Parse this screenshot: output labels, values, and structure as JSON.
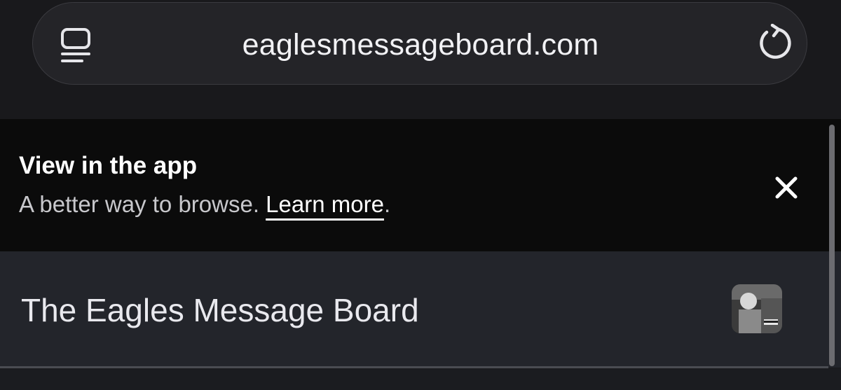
{
  "browser": {
    "url": "eaglesmessageboard.com",
    "reader_icon": "reader-mode-icon",
    "reload_icon": "reload-icon"
  },
  "banner": {
    "title": "View in the app",
    "subtitle_prefix": "A better way to browse. ",
    "learn_more": "Learn more",
    "subtitle_suffix": ".",
    "close_icon": "close-icon"
  },
  "site": {
    "title": "The Eagles Message Board",
    "avatar_icon": "avatar"
  },
  "colors": {
    "background": "#19191c",
    "banner": "#0b0b0b",
    "header": "#23252b",
    "text": "#ffffff"
  }
}
